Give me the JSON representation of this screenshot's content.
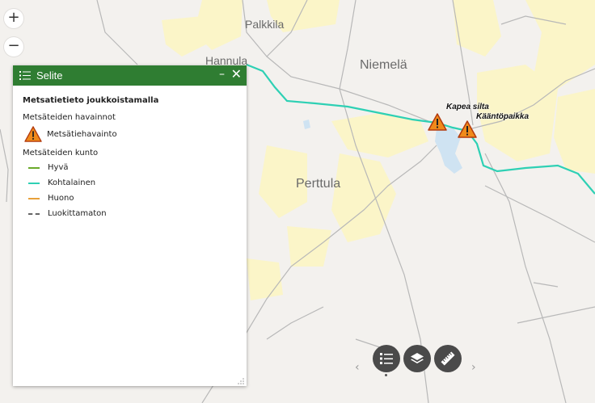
{
  "map": {
    "places": [
      "Palkkila",
      "Hannula",
      "Niemelä",
      "Perttula"
    ],
    "poi_labels": [
      "Kapea silta",
      "Kääntöpaikka"
    ],
    "colors": {
      "background": "#f3f1ee",
      "fields": "#fbf5c8",
      "water": "#cfe3f2",
      "roads": "#b8b8b8",
      "forest_road": "#2ed0b4"
    }
  },
  "zoom": {
    "in": "+",
    "out": "−"
  },
  "legend": {
    "title": "Selite",
    "minimize": "–",
    "close": "✕",
    "heading": "Metsatietieto joukkoistamalla",
    "observations_title": "Metsäteiden havainnot",
    "observation_label": "Metsätiehavainto",
    "condition_title": "Metsäteiden kunto",
    "conditions": [
      {
        "label": "Hyvä",
        "color": "#6aaa2a"
      },
      {
        "label": "Kohtalainen",
        "color": "#2ed0b4"
      },
      {
        "label": "Huono",
        "color": "#e8a13a"
      },
      {
        "label": "Luokittamaton",
        "color": "#666666"
      }
    ],
    "header_color": "#2f7d32"
  },
  "dock": {
    "prev": "‹",
    "next": "›",
    "buttons": [
      "legend-icon",
      "layers-icon",
      "ruler-icon"
    ],
    "button_color": "#4a4a4a"
  }
}
